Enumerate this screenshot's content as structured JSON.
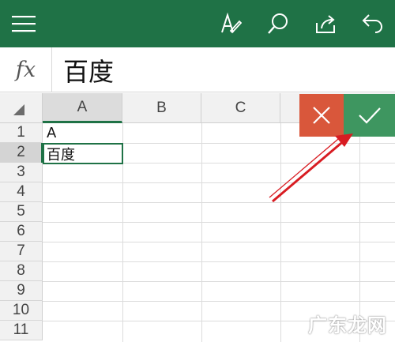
{
  "toolbar": {
    "icons": [
      "menu-icon",
      "pen-icon",
      "search-icon",
      "share-icon",
      "undo-icon"
    ],
    "background": "#1f7246"
  },
  "formula_bar": {
    "fx_label": "fx",
    "value": "百度"
  },
  "grid": {
    "columns": [
      "A",
      "B",
      "C"
    ],
    "rows": [
      "1",
      "2",
      "3",
      "4",
      "5",
      "6",
      "7",
      "8",
      "9",
      "10",
      "11"
    ],
    "cells": {
      "A1": "A",
      "A2": "百度"
    },
    "active_cell": "A2"
  },
  "edit_actions": {
    "cancel_icon": "close-icon",
    "confirm_icon": "check-icon",
    "cancel_color": "#d9573b",
    "confirm_color": "#3e9660"
  },
  "watermark": "广东龙网"
}
